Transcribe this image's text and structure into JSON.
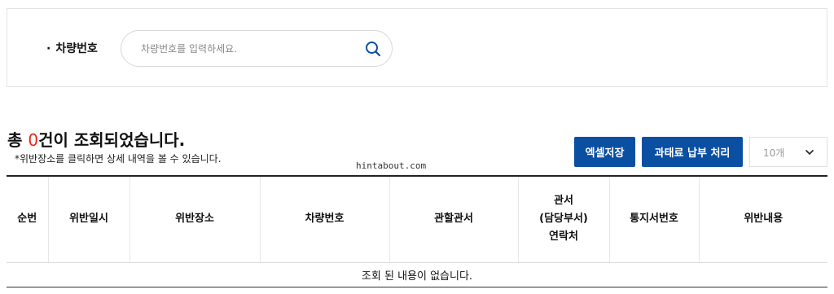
{
  "search": {
    "bullet": "·",
    "label": "차량번호",
    "placeholder": "차량번호를 입력하세요."
  },
  "result": {
    "prefix": "총 ",
    "count": "0",
    "suffix": "건이 조회되었습니다.",
    "notice": "*위반장소를 클릭하면 상세 내역을 볼 수 있습니다."
  },
  "watermark": "hintabout.com",
  "actions": {
    "excel_label": "엑셀저장",
    "fine_label": "과태료 납부 처리",
    "page_size": "10개"
  },
  "table": {
    "columns": [
      "순번",
      "위반일시",
      "위반장소",
      "차량번호",
      "관할관서",
      "관서\n(담당부서)\n연락처",
      "통지서번호",
      "위반내용"
    ],
    "empty_message": "조회 된 내용이 없습니다."
  },
  "colors": {
    "accent": "#0b4fa3",
    "count": "#e8261a"
  }
}
